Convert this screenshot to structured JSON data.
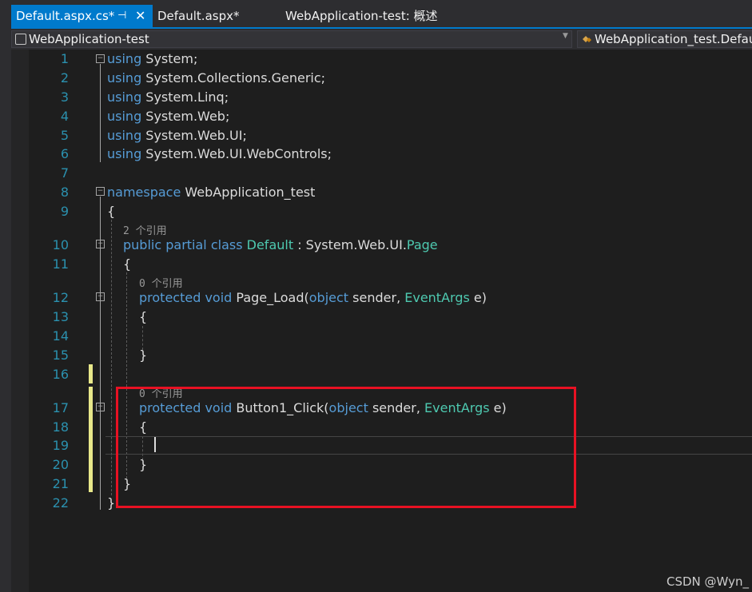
{
  "tabs": {
    "active_label": "Default.aspx.cs*",
    "pin_glyph": "⊣",
    "close_glyph": "✕",
    "second_label": "Default.aspx*",
    "third_label": "WebApplication-test: 概述"
  },
  "navbar": {
    "project": "WebApplication-test",
    "class_path": "WebApplication_test.Defau"
  },
  "line_numbers": [
    "1",
    "2",
    "3",
    "4",
    "5",
    "6",
    "7",
    "8",
    "9",
    "10",
    "11",
    "12",
    "13",
    "14",
    "15",
    "16",
    "17",
    "18",
    "19",
    "20",
    "21",
    "22"
  ],
  "code": {
    "l1": {
      "kw": "using",
      "rest": " System;"
    },
    "l2": {
      "kw": "using",
      "rest": " System.Collections.Generic;"
    },
    "l3": {
      "kw": "using",
      "rest": " System.Linq;"
    },
    "l4": {
      "kw": "using",
      "rest": " System.Web;"
    },
    "l5": {
      "kw": "using",
      "rest": " System.Web.UI;"
    },
    "l6": {
      "kw": "using",
      "rest": " System.Web.UI.WebControls;"
    },
    "l8": {
      "kw": "namespace",
      "rest": " WebApplication_test"
    },
    "l9": "{",
    "ref_class": "2 个引用",
    "l10": {
      "kw": "public partial class",
      "type": "Default",
      "sep": " : System.Web.UI.",
      "base": "Page"
    },
    "l11": "{",
    "ref_pageload": "0 个引用",
    "l12": {
      "kw1": "protected void",
      "name": " Page_Load(",
      "kw2": "object",
      "mid": " sender, ",
      "type": "EventArgs",
      "end": " e)"
    },
    "l13": "{",
    "l15": "}",
    "ref_button": "0 个引用",
    "l17": {
      "kw1": "protected void",
      "name": " Button1_Click(",
      "kw2": "object",
      "mid": " sender, ",
      "type": "EventArgs",
      "end": " e)"
    },
    "l18": "{",
    "l20": "}",
    "l21": "}",
    "l22": "}"
  },
  "watermark": "CSDN @Wyn_",
  "colors": {
    "keyword": "#569cd6",
    "type": "#4ec9b0",
    "line_number": "#2b91af",
    "highlight_box": "#e81123",
    "accent": "#007acc"
  }
}
